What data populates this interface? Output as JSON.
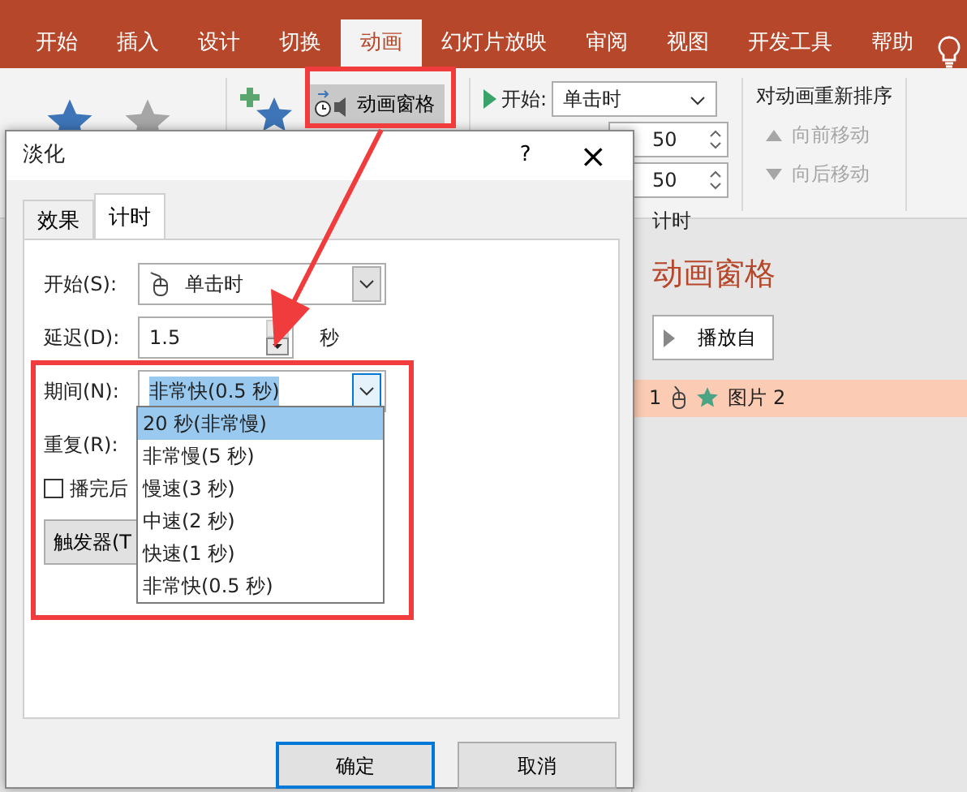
{
  "ribbon": {
    "tabs": [
      {
        "label": "开始",
        "selected": false
      },
      {
        "label": "插入",
        "selected": false
      },
      {
        "label": "设计",
        "selected": false
      },
      {
        "label": "切换",
        "selected": false
      },
      {
        "label": "动画",
        "selected": true
      },
      {
        "label": "幻灯片放映",
        "selected": false
      },
      {
        "label": "审阅",
        "selected": false
      },
      {
        "label": "视图",
        "selected": false
      },
      {
        "label": "开发工具",
        "selected": false
      },
      {
        "label": "帮助",
        "selected": false
      }
    ],
    "animation_pane_button": "动画窗格",
    "start_label": "开始:",
    "start_value": "单击时",
    "duration_values": [
      "50",
      "50"
    ],
    "reorder_title": "对动画重新排序",
    "reorder_buttons": [
      {
        "kind": "up",
        "label": "向前移动",
        "disabled": true
      },
      {
        "kind": "down",
        "label": "向后移动",
        "disabled": true
      }
    ],
    "group_label": "计时"
  },
  "animation_pane": {
    "title": "动画窗格",
    "play_button": "播放自",
    "items": [
      {
        "number": "1",
        "name": "图片 2",
        "selected": true
      }
    ]
  },
  "dialog": {
    "title": "淡化",
    "help": "?",
    "close": "×",
    "tabs": [
      {
        "label": "效果",
        "selected": false
      },
      {
        "label": "计时",
        "selected": true
      }
    ],
    "fields": [
      {
        "kind": "combo",
        "label": "开始(S):",
        "value": "单击时"
      },
      {
        "kind": "spinner",
        "label": "延迟(D):",
        "value": "1.5",
        "unit": "秒"
      },
      {
        "kind": "combo",
        "label": "期间(N):",
        "value": "非常快(0.5 秒)",
        "expanded": true
      },
      {
        "kind": "plain",
        "label": "重复(R):"
      }
    ],
    "checkbox": {
      "label": "播完后",
      "checked": false
    },
    "trigger_button": "触发器(T",
    "dropdown_options": [
      {
        "label": "20 秒(非常慢)",
        "selected": true
      },
      {
        "label": "非常慢(5 秒)",
        "selected": false
      },
      {
        "label": "慢速(3 秒)",
        "selected": false
      },
      {
        "label": "中速(2 秒)",
        "selected": false
      },
      {
        "label": "快速(1 秒)",
        "selected": false
      },
      {
        "label": "非常快(0.5 秒)",
        "selected": false
      }
    ],
    "buttons": [
      {
        "label": "确定",
        "default": true
      },
      {
        "label": "取消",
        "default": false
      }
    ]
  }
}
